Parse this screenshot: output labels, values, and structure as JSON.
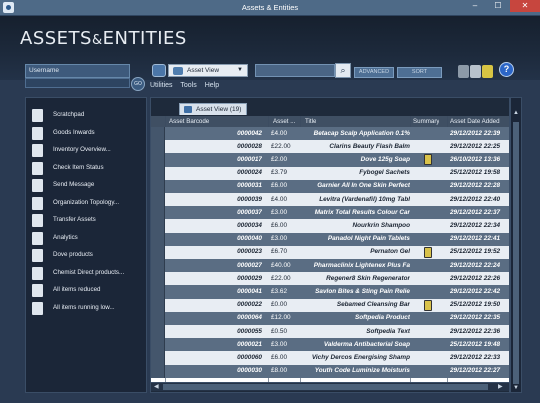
{
  "window": {
    "title": "Assets & Entities",
    "min": "–",
    "max": "☐",
    "close": "✕"
  },
  "logo": {
    "part1": "ASSETS",
    "amp": "&",
    "part2": "ENTITIES"
  },
  "toolbar": {
    "username_placeholder": "Username",
    "go_label": "GO",
    "view_selected": "Asset View",
    "advanced_label": "ADVANCED",
    "sort_label": "SORT",
    "help_label": "?"
  },
  "menu": {
    "utilities": "Utilities",
    "tools": "Tools",
    "help": "Help"
  },
  "sidebar": {
    "items": [
      {
        "label": "Scratchpad"
      },
      {
        "label": "Goods Inwards"
      },
      {
        "label": "Inventory Overview..."
      },
      {
        "label": "Check Item Status"
      },
      {
        "label": "Send Message"
      },
      {
        "label": "Organization Topology..."
      },
      {
        "label": "Transfer Assets"
      },
      {
        "label": "Analytics"
      },
      {
        "label": "Dove products"
      },
      {
        "label": "Chemist Direct products..."
      },
      {
        "label": "All items reduced"
      },
      {
        "label": "All items running low..."
      }
    ]
  },
  "tab": {
    "label": "Asset View (19)"
  },
  "grid": {
    "columns": [
      "Asset Barcode",
      "Asset ...",
      "Title",
      "Summary",
      "Asset Date Added"
    ],
    "rows": [
      {
        "barcode": "0000042",
        "asset": "£4.00",
        "title": "Betacap Scalp Application 0.1%",
        "summary": "",
        "date": "29/12/2012 22:39",
        "icon": false
      },
      {
        "barcode": "0000028",
        "asset": "£22.00",
        "title": "Clarins Beauty Flash Balm",
        "summary": "",
        "date": "29/12/2012 22:25",
        "icon": false
      },
      {
        "barcode": "0000017",
        "asset": "£2.00",
        "title": "Dove 125g Soap",
        "summary": "",
        "date": "26/10/2012 13:36",
        "icon": true
      },
      {
        "barcode": "0000024",
        "asset": "£3.79",
        "title": "Fybogel Sachets",
        "summary": "",
        "date": "25/12/2012 19:58",
        "icon": false
      },
      {
        "barcode": "0000031",
        "asset": "£6.00",
        "title": "Garnier All In One Skin Perfect",
        "summary": "",
        "date": "29/12/2012 22:28",
        "icon": false
      },
      {
        "barcode": "0000039",
        "asset": "£4.00",
        "title": "Levitra (Vardenafil) 10mg Tabl",
        "summary": "",
        "date": "29/12/2012 22:40",
        "icon": false
      },
      {
        "barcode": "0000037",
        "asset": "£3.00",
        "title": "Matrix Total Results Colour Car",
        "summary": "",
        "date": "29/12/2012 22:37",
        "icon": false
      },
      {
        "barcode": "0000034",
        "asset": "£6.00",
        "title": "Nourkrin Shampoo",
        "summary": "",
        "date": "29/12/2012 22:34",
        "icon": false
      },
      {
        "barcode": "0000040",
        "asset": "£3.00",
        "title": "Panadol Night Pain Tablets",
        "summary": "",
        "date": "29/12/2012 22:41",
        "icon": false
      },
      {
        "barcode": "0000023",
        "asset": "£6.70",
        "title": "Pernaton Gel",
        "summary": "",
        "date": "25/12/2012 19:52",
        "icon": true
      },
      {
        "barcode": "0000027",
        "asset": "£40.00",
        "title": "Pharmaclinix Lightenex Plus Fa",
        "summary": "",
        "date": "29/12/2012 22:24",
        "icon": false
      },
      {
        "barcode": "0000029",
        "asset": "£22.00",
        "title": "Regener8 Skin Regenerator",
        "summary": "",
        "date": "29/12/2012 22:26",
        "icon": false
      },
      {
        "barcode": "0000041",
        "asset": "£3.62",
        "title": "Savlon Bites & Sting Pain Relie",
        "summary": "",
        "date": "29/12/2012 22:42",
        "icon": false
      },
      {
        "barcode": "0000022",
        "asset": "£0.00",
        "title": "Sebamed Cleansing Bar",
        "summary": "",
        "date": "25/12/2012 19:50",
        "icon": true
      },
      {
        "barcode": "0000064",
        "asset": "£12.00",
        "title": "Softpedia Product",
        "summary": "",
        "date": "29/12/2012 22:35",
        "icon": false
      },
      {
        "barcode": "0000055",
        "asset": "£0.50",
        "title": "Softpedia Text",
        "summary": "",
        "date": "29/12/2012 22:36",
        "icon": false
      },
      {
        "barcode": "0000021",
        "asset": "£3.00",
        "title": "Valderma Antibacterial Soap",
        "summary": "",
        "date": "25/12/2012 19:48",
        "icon": false
      },
      {
        "barcode": "0000060",
        "asset": "£6.00",
        "title": "Vichy Dercos Energising Shamp",
        "summary": "",
        "date": "29/12/2012 22:33",
        "icon": false
      },
      {
        "barcode": "0000030",
        "asset": "£8.00",
        "title": "Youth Code Luminize Moisturis",
        "summary": "",
        "date": "29/12/2012 22:27",
        "icon": false
      }
    ]
  },
  "colors": {
    "row_dark": "#5a6d83",
    "row_light": "#e8edf3",
    "accent_blue": "#2c66c7",
    "close_red": "#c7463e"
  }
}
